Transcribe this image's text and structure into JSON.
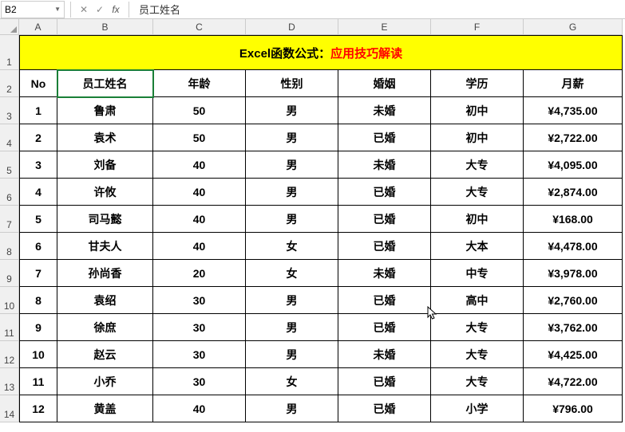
{
  "formula_bar": {
    "cell_ref": "B2",
    "formula_value": "员工姓名"
  },
  "columns": [
    "A",
    "B",
    "C",
    "D",
    "E",
    "F",
    "G"
  ],
  "row_numbers": [
    "1",
    "2",
    "3",
    "4",
    "5",
    "6",
    "7",
    "8",
    "9",
    "10",
    "11",
    "12",
    "13",
    "14"
  ],
  "title": {
    "part1": "Excel函数公式：",
    "part2": "应用技巧解读"
  },
  "headers": {
    "no": "No",
    "name": "员工姓名",
    "age": "年龄",
    "gender": "性别",
    "marriage": "婚姻",
    "education": "学历",
    "salary": "月薪"
  },
  "chart_data": {
    "type": "table",
    "title": "Excel函数公式：应用技巧解读",
    "columns": [
      "No",
      "员工姓名",
      "年龄",
      "性别",
      "婚姻",
      "学历",
      "月薪"
    ],
    "rows": [
      {
        "no": "1",
        "name": "鲁肃",
        "age": "50",
        "gender": "男",
        "marriage": "未婚",
        "education": "初中",
        "salary": "¥4,735.00"
      },
      {
        "no": "2",
        "name": "袁术",
        "age": "50",
        "gender": "男",
        "marriage": "已婚",
        "education": "初中",
        "salary": "¥2,722.00"
      },
      {
        "no": "3",
        "name": "刘备",
        "age": "40",
        "gender": "男",
        "marriage": "未婚",
        "education": "大专",
        "salary": "¥4,095.00"
      },
      {
        "no": "4",
        "name": "许攸",
        "age": "40",
        "gender": "男",
        "marriage": "已婚",
        "education": "大专",
        "salary": "¥2,874.00"
      },
      {
        "no": "5",
        "name": "司马懿",
        "age": "40",
        "gender": "男",
        "marriage": "已婚",
        "education": "初中",
        "salary": "¥168.00"
      },
      {
        "no": "6",
        "name": "甘夫人",
        "age": "40",
        "gender": "女",
        "marriage": "已婚",
        "education": "大本",
        "salary": "¥4,478.00"
      },
      {
        "no": "7",
        "name": "孙尚香",
        "age": "20",
        "gender": "女",
        "marriage": "未婚",
        "education": "中专",
        "salary": "¥3,978.00"
      },
      {
        "no": "8",
        "name": "袁绍",
        "age": "30",
        "gender": "男",
        "marriage": "已婚",
        "education": "高中",
        "salary": "¥2,760.00"
      },
      {
        "no": "9",
        "name": "徐庶",
        "age": "30",
        "gender": "男",
        "marriage": "已婚",
        "education": "大专",
        "salary": "¥3,762.00"
      },
      {
        "no": "10",
        "name": "赵云",
        "age": "30",
        "gender": "男",
        "marriage": "未婚",
        "education": "大专",
        "salary": "¥4,425.00"
      },
      {
        "no": "11",
        "name": "小乔",
        "age": "30",
        "gender": "女",
        "marriage": "已婚",
        "education": "大专",
        "salary": "¥4,722.00"
      },
      {
        "no": "12",
        "name": "黄盖",
        "age": "40",
        "gender": "男",
        "marriage": "已婚",
        "education": "小学",
        "salary": "¥796.00"
      }
    ]
  }
}
